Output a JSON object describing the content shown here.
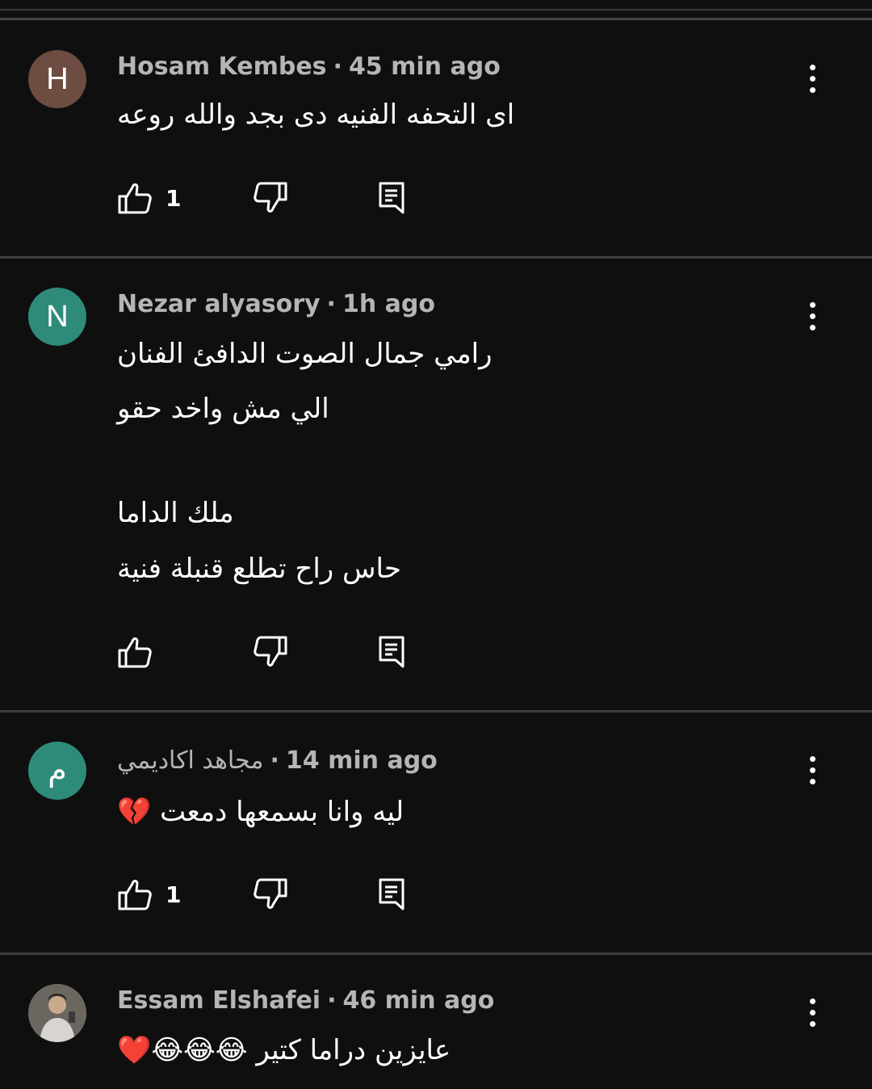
{
  "comments": [
    {
      "avatar_letter": "H",
      "avatar_color": "#6d4c41",
      "author": "Hosam Kembes",
      "separator": "·",
      "time": "45 min ago",
      "lines": [
        "اى التحفه الفنيه دى بجد والله روعه"
      ],
      "like_count": "1"
    },
    {
      "avatar_letter": "N",
      "avatar_color": "#2e8b7a",
      "author": "Nezar alyasory",
      "separator": "·",
      "time": "1h ago",
      "lines": [
        "رامي جمال الصوت الدافئ الفنان",
        "الي مش واخد حقو",
        "ملك الداما",
        "حاس راح تطلع قنبلة فنية"
      ],
      "like_count": ""
    },
    {
      "avatar_letter": "م",
      "avatar_color": "#2e8b7a",
      "author": "مجاهد اكاديمي",
      "separator": "·",
      "time": "14 min ago",
      "lines": [
        "ليه وانا بسمعها دمعت 💔"
      ],
      "like_count": "1"
    },
    {
      "avatar_letter": "",
      "avatar_color": "#5a5550",
      "author": "Essam Elshafei",
      "separator": "·",
      "time": "46 min ago",
      "lines": [
        "عايزين دراما كتير 😂😂😂❤️"
      ],
      "like_count": ""
    }
  ],
  "icons": {
    "like": "thumbs-up-icon",
    "dislike": "thumbs-down-icon",
    "reply": "reply-comment-icon",
    "more": "more-vert-icon"
  }
}
